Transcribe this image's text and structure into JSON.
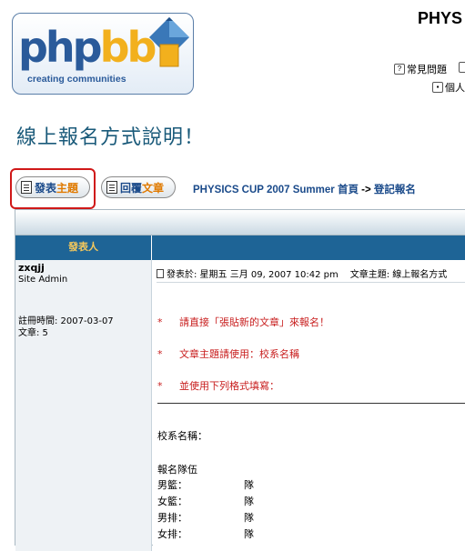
{
  "logo": {
    "php": "php",
    "bb": "bb",
    "tagline": "creating  communities"
  },
  "header": {
    "site_title": "PHYS"
  },
  "top_links": [
    {
      "label": "常見問題",
      "icon": "help-icon"
    },
    {
      "label": "個人",
      "icon": "profile-icon"
    }
  ],
  "topic_title": "線上報名方式說明！",
  "buttons": {
    "new_topic": {
      "part1": "發表",
      "part2": "主題"
    },
    "reply": {
      "part1": "回覆",
      "part2": "文章"
    }
  },
  "nav": {
    "forum": "PHYSICS CUP 2007 Summer 首頁",
    "arrow": " -> ",
    "sub": "登記報名"
  },
  "table": {
    "author_header": "發表人"
  },
  "post": {
    "author": "zxqjj",
    "rank": "Site Admin",
    "joined": "註冊時間: 2007-03-07",
    "posts": "文章: 5",
    "posted": "發表於: 星期五 三月 09, 2007 10:42 pm",
    "subject": "文章主題: 線上報名方式",
    "lines": [
      {
        "star": "*",
        "text": "請直接「張貼新的文章」來報名！"
      },
      {
        "star": "*",
        "text": "文章主題請使用：校系名稱"
      },
      {
        "star": "*",
        "text": "並使用下列格式填寫："
      }
    ],
    "school_label": "校系名稱：",
    "team_label": "報名隊伍",
    "teams": [
      {
        "label": "男籃：",
        "unit": "隊"
      },
      {
        "label": "女籃：",
        "unit": "隊"
      },
      {
        "label": "男排：",
        "unit": "隊"
      },
      {
        "label": "女排：",
        "unit": "隊"
      }
    ]
  },
  "colors": {
    "header_blue": "#1e6496",
    "accent_orange": "#e07a00",
    "title_blue": "#1a5a7a",
    "red_text": "#c81e1e",
    "highlight_red": "#d01818"
  }
}
